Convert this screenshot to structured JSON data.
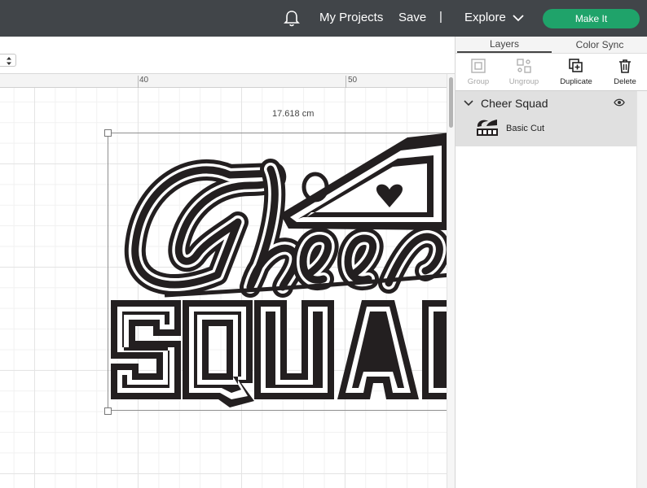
{
  "header": {
    "my_projects": "My Projects",
    "save": "Save",
    "separator": "|",
    "explore": "Explore",
    "make_it": "Make It",
    "bell_icon": "bell-icon"
  },
  "ruler": {
    "labels": [
      "40",
      "50"
    ]
  },
  "canvas": {
    "dimension_label": "17.618 cm",
    "design_name": "Cheer Squad"
  },
  "panel": {
    "tabs": [
      "Layers",
      "Color Sync"
    ],
    "active_tab": "Layers",
    "tools": [
      {
        "label": "Group",
        "icon": "group-icon",
        "enabled": false
      },
      {
        "label": "Ungroup",
        "icon": "ungroup-icon",
        "enabled": false
      },
      {
        "label": "Duplicate",
        "icon": "duplicate-icon",
        "enabled": true
      },
      {
        "label": "Delete",
        "icon": "trash-icon",
        "enabled": true
      }
    ],
    "group": {
      "name": "Cheer Squad",
      "layer_name": "Basic Cut",
      "visible_icon": "eye-icon"
    }
  },
  "colors": {
    "topbar": "#414549",
    "accent": "#1fa36a",
    "design": "#231f20"
  }
}
